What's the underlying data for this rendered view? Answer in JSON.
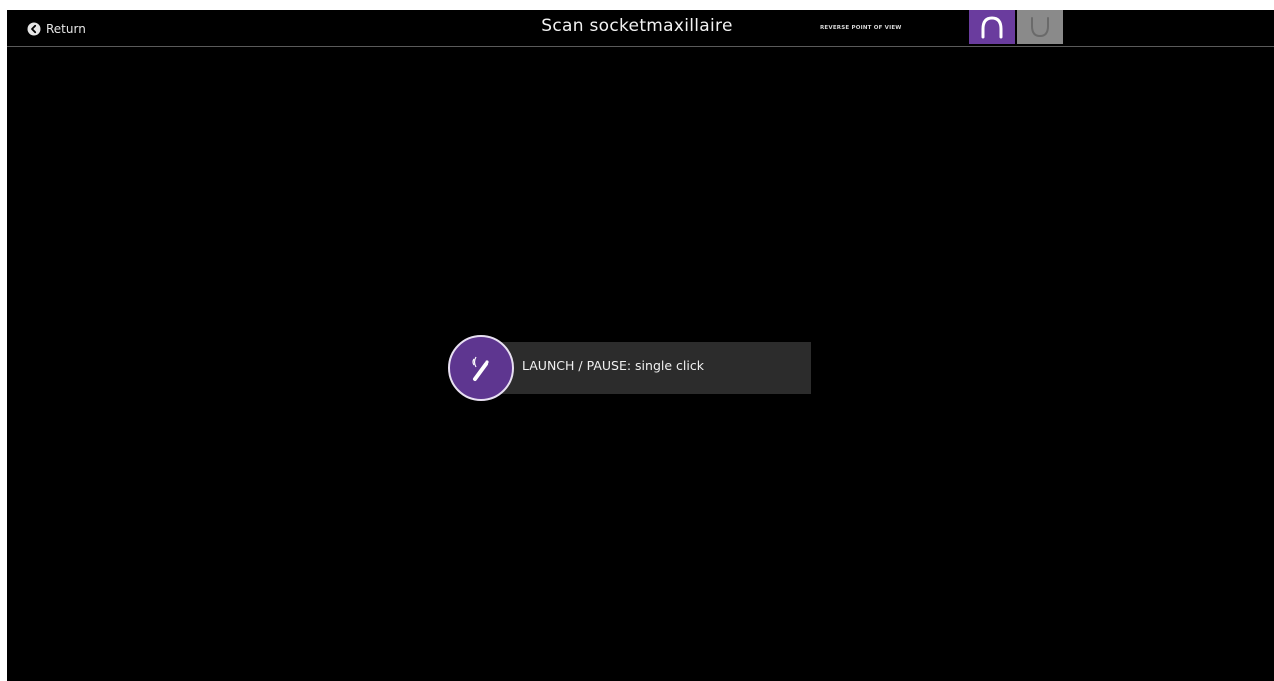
{
  "header": {
    "return_label": "Return",
    "title": "Scan socketmaxillaire",
    "reverse_label": "REVERSE POINT OF VIEW"
  },
  "view_toggle": {
    "selected": "upper",
    "accent_color": "#6a3c9e",
    "inactive_color": "#8a8a8a",
    "options": [
      {
        "name": "upper-arch",
        "icon": "upper-arch-icon"
      },
      {
        "name": "lower-arch",
        "icon": "lower-arch-icon"
      }
    ]
  },
  "instruction": {
    "icon": "scanner-wand-icon",
    "text": "LAUNCH / PAUSE: single click"
  }
}
